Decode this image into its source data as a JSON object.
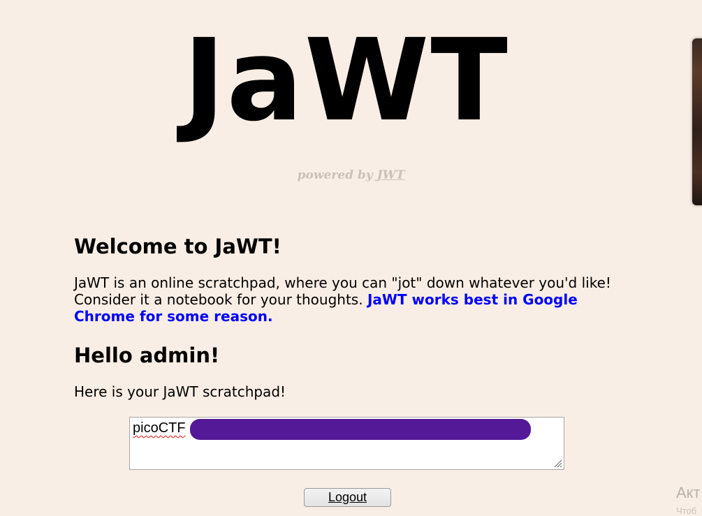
{
  "header": {
    "logo": "JaWT",
    "powered_prefix": "powered by ",
    "powered_link": "JWT"
  },
  "main": {
    "welcome_heading": "Welcome to JaWT!",
    "intro_text": " JaWT is an online scratchpad, where you can \"jot\" down whatever you'd like! Consider it a notebook for your thoughts. ",
    "intro_note": "JaWT works best in Google Chrome for some reason.",
    "greeting": "Hello admin!",
    "scratchpad_label": " Here is your JaWT scratchpad!",
    "scratchpad_value": "picoCTF",
    "logout_label": "Logout"
  },
  "overlay": {
    "activate_text": "Акт",
    "activate_sub": "Чтоб"
  },
  "colors": {
    "background": "#f9eee5",
    "note_blue": "#0000ff",
    "redaction": "#4b0d91",
    "muted": "#c9c1ba"
  }
}
